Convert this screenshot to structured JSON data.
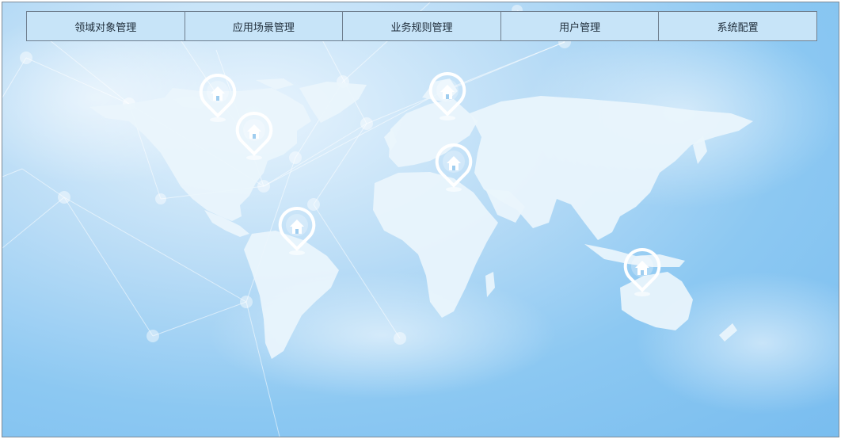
{
  "nav": {
    "items": [
      {
        "label": "领域对象管理"
      },
      {
        "label": "应用场景管理"
      },
      {
        "label": "业务规则管理"
      },
      {
        "label": "用户管理"
      },
      {
        "label": "系统配置"
      }
    ]
  },
  "map": {
    "pin_icon": "home-location-pin",
    "colors": {
      "background": "#8cc8f2",
      "continent": "#eaf5fc",
      "network_line": "#ffffff"
    }
  }
}
